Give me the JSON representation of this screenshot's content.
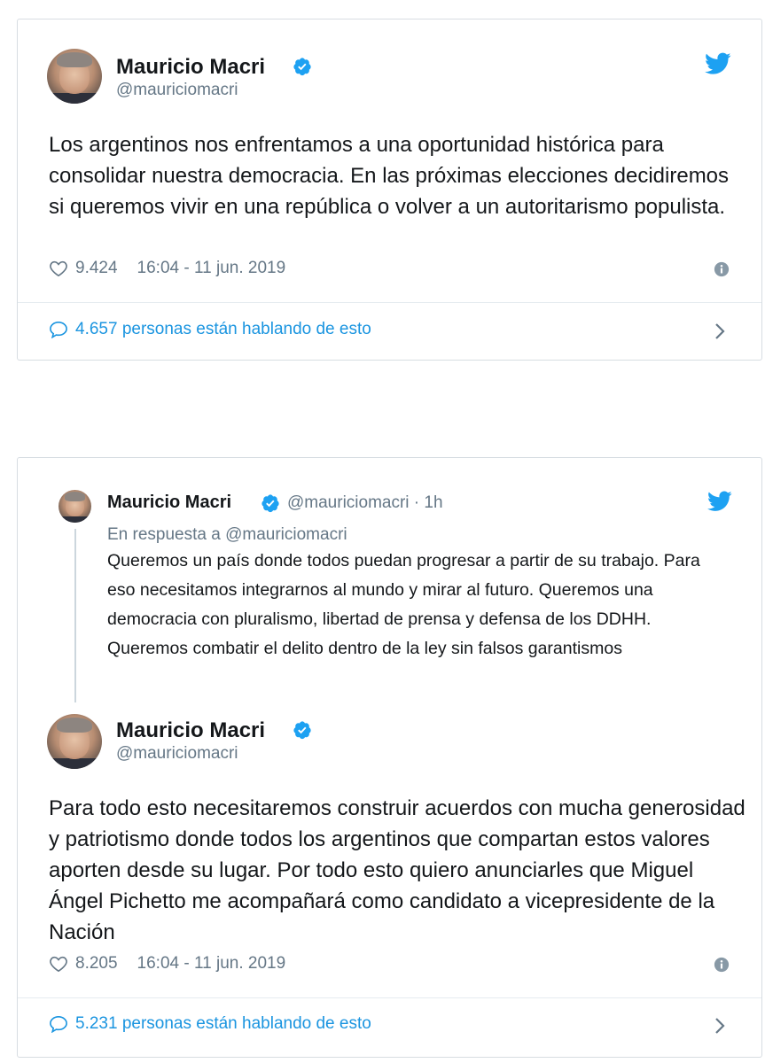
{
  "colors": {
    "accent": "#1b95e0",
    "muted": "#657786",
    "text": "#14171a",
    "border": "#d7dde2"
  },
  "tweet1": {
    "author": {
      "name": "Mauricio Macri",
      "handle": "@mauriciomacri",
      "verified": true,
      "avatar_icon": "avatar-photo"
    },
    "text": "Los argentinos nos enfrentamos a una oportunidad histórica para consolidar nuestra democracia. En las próximas elecciones decidiremos si queremos vivir en una república o volver a un autoritarismo populista.",
    "likes": "9.424",
    "timestamp": "16:04 - 11 jun. 2019",
    "talking": "4.657 personas están hablando de esto"
  },
  "tweet2": {
    "quoted": {
      "name": "Mauricio Macri",
      "handle_time": "@mauriciomacri · 1h",
      "reply_to": "En respuesta a @mauriciomacri",
      "text": "Queremos un país donde todos puedan progresar a partir de su trabajo. Para eso necesitamos integrarnos al mundo y mirar al futuro. Queremos una democracia con pluralismo, libertad de prensa y defensa de los DDHH. Queremos combatir el delito dentro de la ley sin falsos garantismos"
    },
    "author": {
      "name": "Mauricio Macri",
      "handle": "@mauriciomacri",
      "verified": true,
      "avatar_icon": "avatar-photo"
    },
    "text": "Para todo esto necesitaremos construir acuerdos con mucha generosidad y patriotismo donde todos los argentinos que compartan estos valores aporten desde su lugar. Por todo esto quiero anunciarles que Miguel Ángel Pichetto me acompañará como candidato a vicepresidente de la Nación",
    "likes": "8.205",
    "timestamp": "16:04 - 11 jun. 2019",
    "talking": "5.231 personas están hablando de esto"
  }
}
